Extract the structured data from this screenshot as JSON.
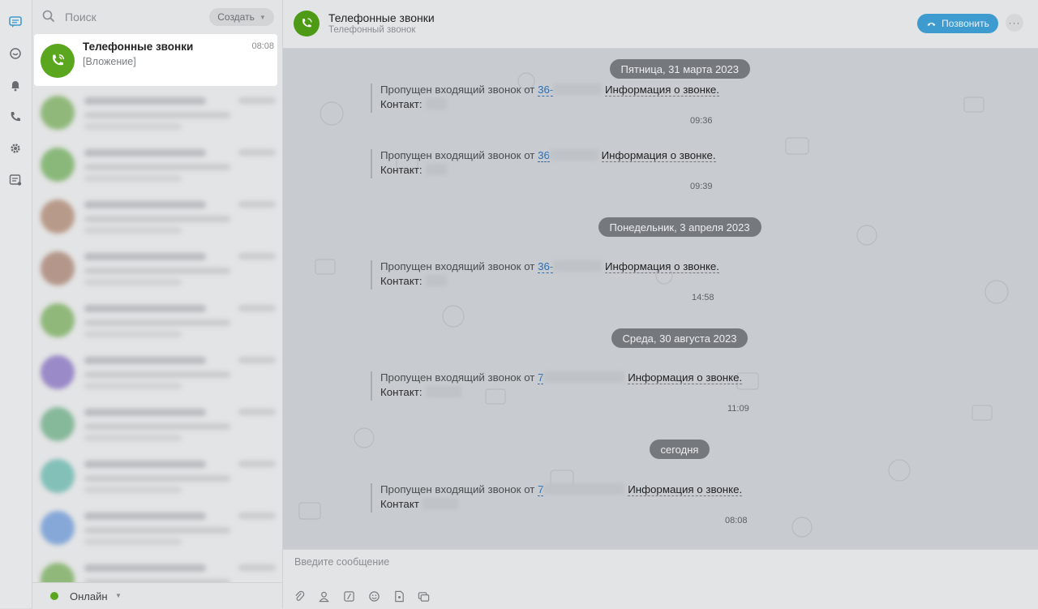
{
  "search": {
    "placeholder": "Поиск",
    "create_label": "Создать"
  },
  "active_chat": {
    "title": "Телефонные звонки",
    "preview": "[Вложение]",
    "time": "08:08"
  },
  "status": {
    "label": "Онлайн",
    "color": "#5aa61e"
  },
  "header": {
    "title": "Телефонные звонки",
    "subtitle": "Телефонный звонок",
    "call_label": "Позвонить",
    "more_label": "···"
  },
  "dates": [
    "Пятница, 31 марта 2023",
    "Понедельник, 3 апреля 2023",
    "Среда, 30 августа 2023",
    "сегодня"
  ],
  "messages": [
    {
      "prefix": "Пропущен входящий звонок от",
      "number": "36-",
      "info": "Информация о звонке.",
      "contact": "Контакт:",
      "time": "09:36"
    },
    {
      "prefix": "Пропущен входящий звонок от",
      "number": "36",
      "info": "Информация о звонке.",
      "contact": "Контакт:",
      "time": "09:39"
    },
    {
      "prefix": "Пропущен входящий звонок от",
      "number": "36-",
      "info": "Информация о звонке.",
      "contact": "Контакт:",
      "time": "14:58"
    },
    {
      "prefix": "Пропущен входящий звонок от",
      "number": "7",
      "info": "Информация о звонке.",
      "contact": "Контакт:",
      "time": "11:09"
    },
    {
      "prefix": "Пропущен входящий звонок от",
      "number": "7",
      "info": "Информация о звонке.",
      "contact": "Контакт",
      "time": "08:08"
    }
  ],
  "composer": {
    "placeholder": "Введите сообщение"
  },
  "blurred_avatar_colors": [
    "#8fb87a",
    "#8ab87a",
    "#b89a8a",
    "#b4978a",
    "#8fb87a",
    "#9a8ac8",
    "#86b89a",
    "#82c0b8",
    "#86a8d8",
    "#8fb87a"
  ]
}
